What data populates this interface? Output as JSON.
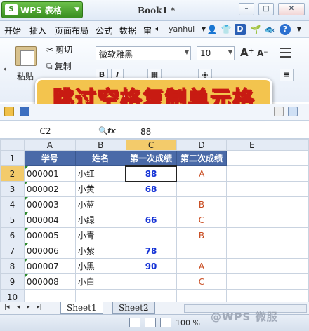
{
  "app": {
    "brand": "WPS 表格",
    "logo_text": "S",
    "document_title": "Book1 *"
  },
  "window_buttons": [
    "–",
    "□",
    "✕"
  ],
  "menu": {
    "items": [
      "开始",
      "插入",
      "页面布局",
      "公式",
      "数据",
      "审"
    ],
    "more": "◂",
    "user": "yanhui"
  },
  "ribbon": {
    "paste_label": "粘贴",
    "cut_label": "剪切",
    "copy_label": "复制",
    "font_name": "微软雅黑",
    "font_size": "10",
    "bold": "B",
    "italic": "I",
    "grow_font": "A⁺",
    "shrink_font": "A⁻"
  },
  "banner": {
    "text": "跳过空格复制单元格"
  },
  "formula_bar": {
    "cell_ref": "C2",
    "fx": "fx",
    "value": "88"
  },
  "sheet": {
    "columns": [
      "A",
      "B",
      "C",
      "D",
      "E"
    ],
    "rows": [
      "1",
      "2",
      "3",
      "4",
      "5",
      "6",
      "7",
      "8",
      "9",
      "10"
    ],
    "headers": [
      "学号",
      "姓名",
      "第一次成绩",
      "第二次成绩"
    ],
    "data": [
      {
        "id": "000001",
        "name": "小红",
        "s1": "88",
        "s2": "A"
      },
      {
        "id": "000002",
        "name": "小黄",
        "s1": "68",
        "s2": ""
      },
      {
        "id": "000003",
        "name": "小蓝",
        "s1": "",
        "s2": "B"
      },
      {
        "id": "000004",
        "name": "小绿",
        "s1": "66",
        "s2": "C"
      },
      {
        "id": "000005",
        "name": "小青",
        "s1": "",
        "s2": "B"
      },
      {
        "id": "000006",
        "name": "小紫",
        "s1": "78",
        "s2": ""
      },
      {
        "id": "000007",
        "name": "小黑",
        "s1": "90",
        "s2": "A"
      },
      {
        "id": "000008",
        "name": "小白",
        "s1": "",
        "s2": "C"
      }
    ]
  },
  "tabs": [
    "Sheet1",
    "Sheet2"
  ],
  "status": {
    "zoom": "100 %",
    "watermark": "@WPS 微服"
  },
  "colors": {
    "header_fill": "#4a6aa8",
    "score1": "#1432d6",
    "score2": "#c84a1e",
    "banner": "#f3c44e"
  }
}
